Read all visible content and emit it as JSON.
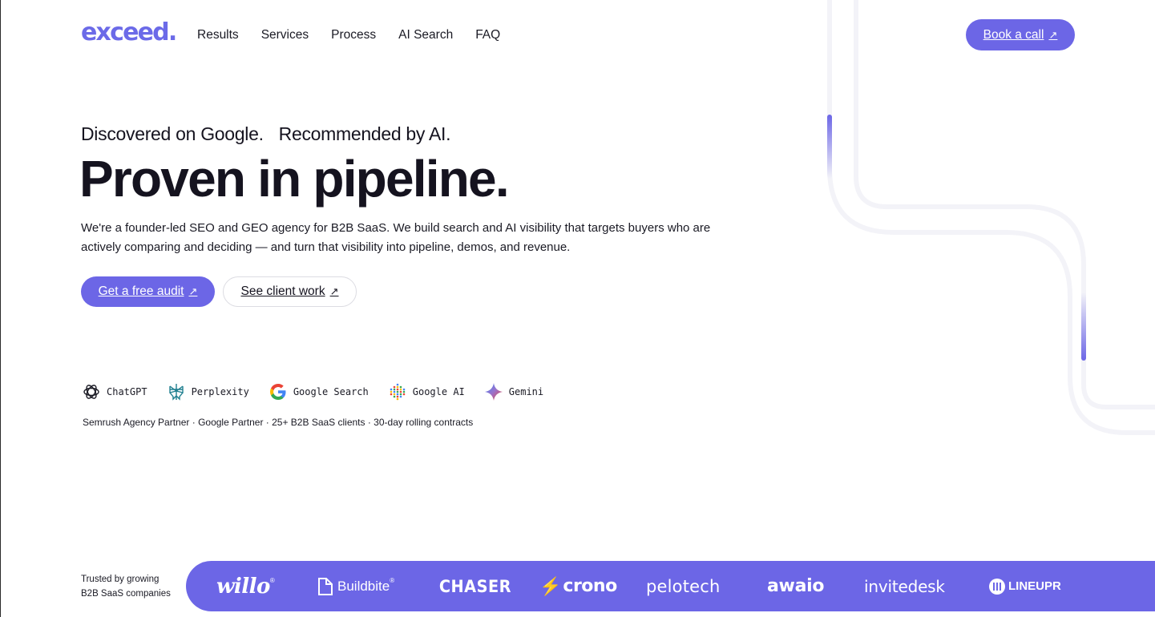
{
  "header": {
    "logo": "exceed.",
    "nav": [
      "Results",
      "Services",
      "Process",
      "AI Search",
      "FAQ"
    ],
    "cta": "Book a call"
  },
  "hero": {
    "kicker_1": "Discovered on Google.",
    "kicker_2": "Recommended by AI.",
    "headline": "Proven in pipeline.",
    "description": "We're a founder-led SEO and GEO agency for B2B SaaS. We build search and AI visibility that targets buyers who are actively comparing and deciding — and turn that visibility into pipeline, demos, and revenue.",
    "primary_cta": "Get a free audit",
    "secondary_cta": "See client work"
  },
  "platforms": [
    {
      "label": "ChatGPT",
      "icon": "chatgpt-icon"
    },
    {
      "label": "Perplexity",
      "icon": "perplexity-icon"
    },
    {
      "label": "Google Search",
      "icon": "google-icon"
    },
    {
      "label": "Google AI",
      "icon": "google-ai-icon"
    },
    {
      "label": "Gemini",
      "icon": "gemini-icon"
    }
  ],
  "credentials": "Semrush Agency Partner · Google Partner · 25+ B2B SaaS clients · 30-day rolling contracts",
  "trusted": {
    "line_1": "Trusted by growing",
    "line_2": "B2B SaaS companies"
  },
  "clients": [
    "willo",
    "Buildbite",
    "CHASER",
    "crono",
    "pelotech",
    "awaio",
    "invitedesk",
    "LINEUPR"
  ],
  "colors": {
    "accent": "#6c66e6",
    "text": "#15131f",
    "rail": "#f2f2f8"
  }
}
